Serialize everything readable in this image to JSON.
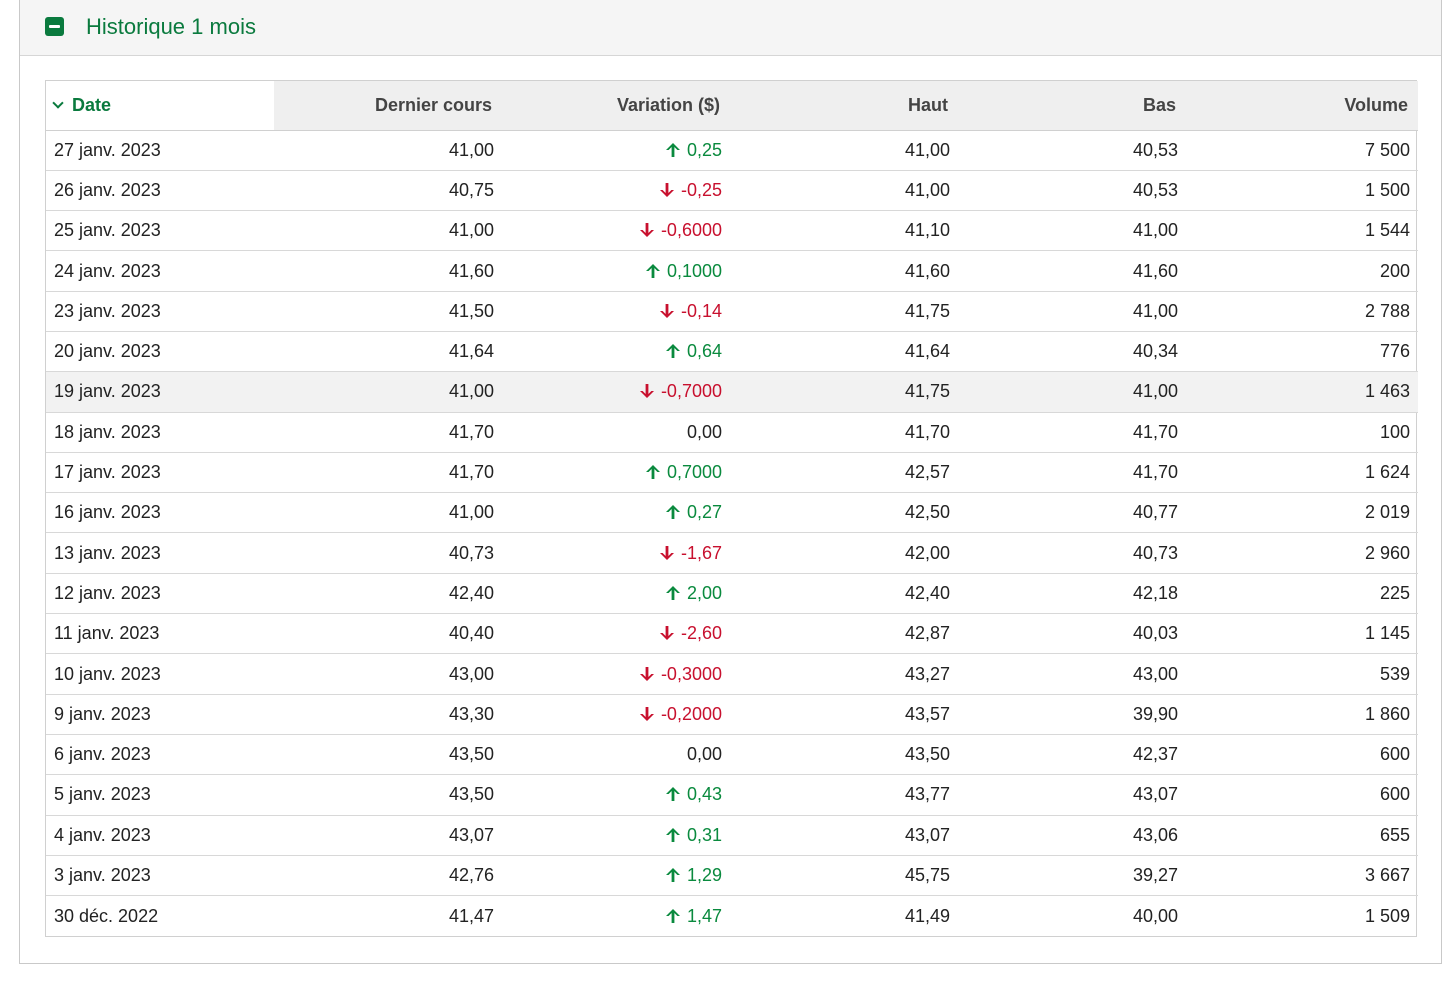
{
  "section": {
    "title": "Historique 1 mois"
  },
  "table": {
    "headers": [
      "Date",
      "Dernier cours",
      "Variation ($)",
      "Haut",
      "Bas",
      "Volume"
    ],
    "highlighted_row": 6,
    "rows": [
      {
        "date": "27 janv. 2023",
        "close": "41,00",
        "change": "0,25",
        "dir": "up",
        "high": "41,00",
        "low": "40,53",
        "volume": "7 500"
      },
      {
        "date": "26 janv. 2023",
        "close": "40,75",
        "change": "-0,25",
        "dir": "down",
        "high": "41,00",
        "low": "40,53",
        "volume": "1 500"
      },
      {
        "date": "25 janv. 2023",
        "close": "41,00",
        "change": "-0,6000",
        "dir": "down",
        "high": "41,10",
        "low": "41,00",
        "volume": "1 544"
      },
      {
        "date": "24 janv. 2023",
        "close": "41,60",
        "change": "0,1000",
        "dir": "up",
        "high": "41,60",
        "low": "41,60",
        "volume": "200"
      },
      {
        "date": "23 janv. 2023",
        "close": "41,50",
        "change": "-0,14",
        "dir": "down",
        "high": "41,75",
        "low": "41,00",
        "volume": "2 788"
      },
      {
        "date": "20 janv. 2023",
        "close": "41,64",
        "change": "0,64",
        "dir": "up",
        "high": "41,64",
        "low": "40,34",
        "volume": "776"
      },
      {
        "date": "19 janv. 2023",
        "close": "41,00",
        "change": "-0,7000",
        "dir": "down",
        "high": "41,75",
        "low": "41,00",
        "volume": "1 463"
      },
      {
        "date": "18 janv. 2023",
        "close": "41,70",
        "change": "0,00",
        "dir": "flat",
        "high": "41,70",
        "low": "41,70",
        "volume": "100"
      },
      {
        "date": "17 janv. 2023",
        "close": "41,70",
        "change": "0,7000",
        "dir": "up",
        "high": "42,57",
        "low": "41,70",
        "volume": "1 624"
      },
      {
        "date": "16 janv. 2023",
        "close": "41,00",
        "change": "0,27",
        "dir": "up",
        "high": "42,50",
        "low": "40,77",
        "volume": "2 019"
      },
      {
        "date": "13 janv. 2023",
        "close": "40,73",
        "change": "-1,67",
        "dir": "down",
        "high": "42,00",
        "low": "40,73",
        "volume": "2 960"
      },
      {
        "date": "12 janv. 2023",
        "close": "42,40",
        "change": "2,00",
        "dir": "up",
        "high": "42,40",
        "low": "42,18",
        "volume": "225"
      },
      {
        "date": "11 janv. 2023",
        "close": "40,40",
        "change": "-2,60",
        "dir": "down",
        "high": "42,87",
        "low": "40,03",
        "volume": "1 145"
      },
      {
        "date": "10 janv. 2023",
        "close": "43,00",
        "change": "-0,3000",
        "dir": "down",
        "high": "43,27",
        "low": "43,00",
        "volume": "539"
      },
      {
        "date": "9 janv. 2023",
        "close": "43,30",
        "change": "-0,2000",
        "dir": "down",
        "high": "43,57",
        "low": "39,90",
        "volume": "1 860"
      },
      {
        "date": "6 janv. 2023",
        "close": "43,50",
        "change": "0,00",
        "dir": "flat",
        "high": "43,50",
        "low": "42,37",
        "volume": "600"
      },
      {
        "date": "5 janv. 2023",
        "close": "43,50",
        "change": "0,43",
        "dir": "up",
        "high": "43,77",
        "low": "43,07",
        "volume": "600"
      },
      {
        "date": "4 janv. 2023",
        "close": "43,07",
        "change": "0,31",
        "dir": "up",
        "high": "43,07",
        "low": "43,06",
        "volume": "655"
      },
      {
        "date": "3 janv. 2023",
        "close": "42,76",
        "change": "1,29",
        "dir": "up",
        "high": "45,75",
        "low": "39,27",
        "volume": "3 667"
      },
      {
        "date": "30 déc. 2022",
        "close": "41,47",
        "change": "1,47",
        "dir": "up",
        "high": "41,49",
        "low": "40,00",
        "volume": "1 509"
      }
    ]
  }
}
